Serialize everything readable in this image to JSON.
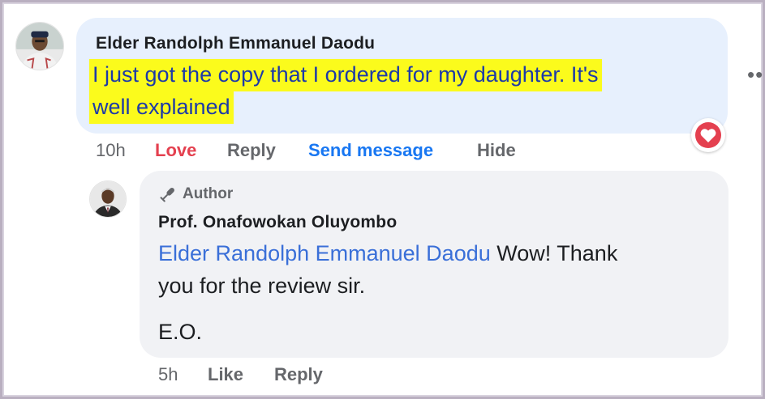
{
  "comment": {
    "author": "Elder Randolph Emmanuel Daodu",
    "text_line1": "I just got the copy that I ordered for my daughter. It's",
    "text_line2": "well explained",
    "more_icon": "ellipsis-icon",
    "reaction_icon": "heart-icon",
    "reaction_color": "#e4404f",
    "time": "10h",
    "actions": {
      "love": "Love",
      "reply": "Reply",
      "send_message": "Send message",
      "hide": "Hide"
    }
  },
  "reply": {
    "badge_icon": "microphone-icon",
    "badge_label": "Author",
    "author": "Prof. Onafowokan Oluyombo",
    "mention": "Elder Randolph Emmanuel Daodu",
    "text_part1": " Wow! Thank",
    "text_part2": "you for the review sir.",
    "signature": "E.O.",
    "time": "5h",
    "actions": {
      "like": "Like",
      "reply": "Reply"
    }
  },
  "colors": {
    "highlight": "#fbfb1c",
    "bubble_primary": "#e7f0fd",
    "bubble_reply": "#f1f2f5",
    "link_blue": "#1877f2",
    "mention_blue": "#3a6fd8"
  }
}
